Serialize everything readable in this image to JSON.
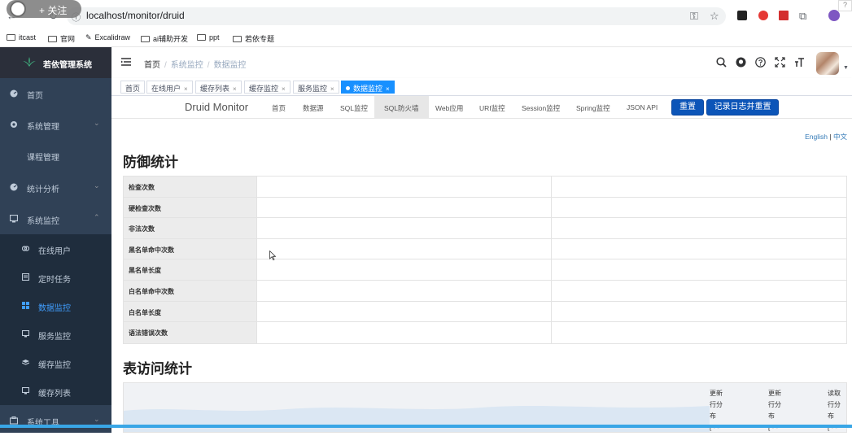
{
  "browser": {
    "url": "localhost/monitor/druid",
    "follow_label": "+ 关注",
    "bookmarks": [
      "itcast",
      "官网",
      "Excalidraw",
      "ai辅助开发",
      "ppt",
      "若依专题"
    ],
    "help_glyph": "?"
  },
  "sidebar": {
    "title": "若依管理系统",
    "items": [
      {
        "label": "首页",
        "icon": "dashboard-icon"
      },
      {
        "label": "系统管理",
        "icon": "gear-icon",
        "chevron": "⌄"
      },
      {
        "label": "课程管理"
      },
      {
        "label": "统计分析",
        "icon": "dashboard-icon",
        "chevron": "⌄"
      },
      {
        "label": "系统监控",
        "icon": "monitor-icon",
        "chevron": "⌃"
      }
    ],
    "sub_items": [
      {
        "label": "在线用户",
        "icon": "online-icon"
      },
      {
        "label": "定时任务",
        "icon": "job-icon"
      },
      {
        "label": "数据监控",
        "icon": "druid-icon",
        "active": true
      },
      {
        "label": "服务监控",
        "icon": "server-icon"
      },
      {
        "label": "缓存监控",
        "icon": "redis-icon"
      },
      {
        "label": "缓存列表",
        "icon": "list-icon"
      }
    ],
    "bottom_item": {
      "label": "系统工具",
      "chevron": "⌄"
    }
  },
  "navbar": {
    "breadcrumb": [
      "首页",
      "系统监控",
      "数据监控"
    ],
    "sep": "/",
    "icons": [
      "search-icon",
      "github-icon",
      "question-icon",
      "fullscreen-icon",
      "font-size-icon"
    ],
    "caret": "▼"
  },
  "tags": [
    {
      "label": "首页",
      "closable": false
    },
    {
      "label": "在线用户",
      "closable": true
    },
    {
      "label": "缓存列表",
      "closable": true
    },
    {
      "label": "缓存监控",
      "closable": true
    },
    {
      "label": "服务监控",
      "closable": true
    },
    {
      "label": "数据监控",
      "closable": true,
      "active": true
    }
  ],
  "tag_close": "×",
  "druid": {
    "brand": "Druid Monitor",
    "nav": [
      "首页",
      "数据源",
      "SQL监控",
      "SQL防火墙",
      "Web应用",
      "URI监控",
      "Session监控",
      "Spring监控",
      "JSON API"
    ],
    "active_nav": "SQL防火墙",
    "reset_button": "重置",
    "log_reset_button": "记录日志并重置",
    "lang_en": "English",
    "lang_sep": "|",
    "lang_zh": "中文"
  },
  "defense": {
    "title": "防御统计",
    "rows": [
      "检查次数",
      "硬检查次数",
      "非法次数",
      "黑名单命中次数",
      "黑名单长度",
      "白名单命中次数",
      "白名单长度",
      "语法错误次数"
    ]
  },
  "table_stats": {
    "title": "表访问统计",
    "columns": [
      {
        "lines": [
          "更新",
          "行分",
          "布",
          "[ - -"
        ]
      },
      {
        "lines": [
          "更新",
          "行分",
          "布",
          "[ - -"
        ]
      },
      {
        "lines": [
          "读取",
          "行分",
          "布",
          "[ - -"
        ]
      }
    ]
  },
  "colors": {
    "sidebar_bg": "#304156",
    "sidebar_active": "#409eff",
    "tag_active": "#1890ff",
    "druid_btn": "#0c55b8"
  }
}
